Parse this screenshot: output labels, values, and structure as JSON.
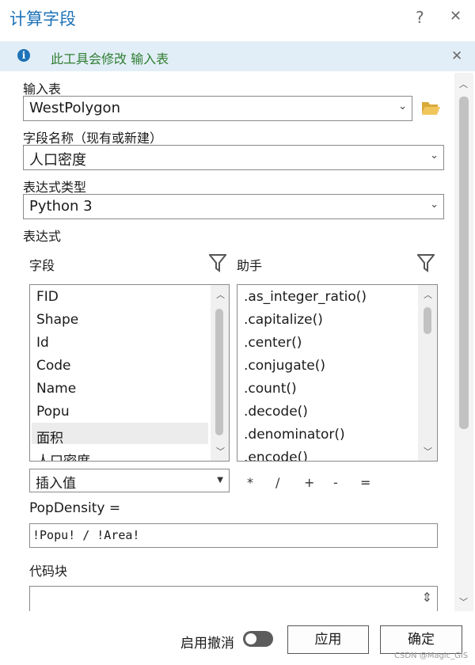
{
  "window": {
    "title": "计算字段",
    "help_glyph": "?",
    "close_glyph": "✕"
  },
  "infobar": {
    "icon_glyph": "i",
    "message": "此工具会修改 输入表",
    "close_glyph": "✕"
  },
  "input_table": {
    "label": "输入表",
    "value": "WestPolygon",
    "icon": "folder-open-icon"
  },
  "field_name": {
    "label": "字段名称（现有或新建）",
    "value": "人口密度"
  },
  "expression_type": {
    "label": "表达式类型",
    "value": "Python 3"
  },
  "expression": {
    "label": "表达式",
    "fields_header": "字段",
    "helpers_header": "助手",
    "fields": [
      "FID",
      "Shape",
      "Id",
      "Code",
      "Name",
      "Popu",
      "面积",
      "人口密度"
    ],
    "helpers": [
      ".as_integer_ratio()",
      ".capitalize()",
      ".center()",
      ".conjugate()",
      ".count()",
      ".decode()",
      ".denominator()",
      ".encode()"
    ],
    "insert_value": "插入值",
    "operators": [
      "*",
      "/",
      "+",
      "-",
      "="
    ],
    "target_label": "PopDensity =",
    "text": "!Popu! / !Area!"
  },
  "code_block": {
    "label": "代码块"
  },
  "footer": {
    "undo_label": "启用撤消",
    "apply": "应用",
    "ok": "确定",
    "watermark": "CSDN @Magic_GIS"
  },
  "colors": {
    "accent": "#1e73b8",
    "info_bg": "#e2eef7",
    "info_text": "#2e7d32",
    "folder": "#e8b84a"
  }
}
